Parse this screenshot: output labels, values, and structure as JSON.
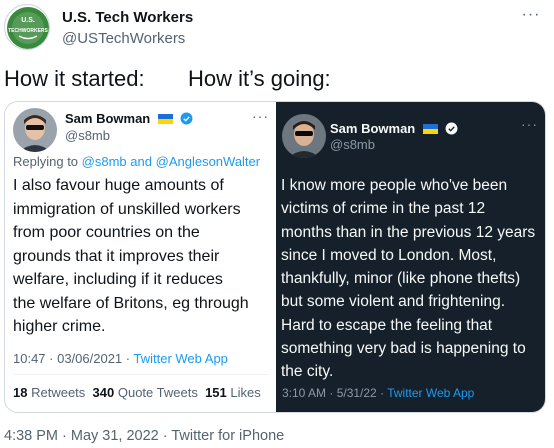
{
  "author": {
    "name": "U.S. Tech Workers",
    "handle": "@USTechWorkers",
    "logo_text_top": "U.S.",
    "logo_text_bottom": "TECHWORKERS"
  },
  "captions": {
    "left": "How it started:",
    "right": "How it’s going:"
  },
  "quoted_left": {
    "name": "Sam Bowman",
    "handle": "@s8mb",
    "replying_prefix": "Replying to",
    "reply_mention_1": "@s8mb",
    "reply_and": "and",
    "reply_mention_2": "@AnglesonWalter",
    "text_lines": [
      "I also favour huge amounts of",
      "immigration of unskilled workers",
      "from poor countries on the",
      "grounds that it improves their",
      "welfare, including if it reduces",
      "the welfare of Britons, eg through",
      "higher crime."
    ],
    "timestamp": "10:47 · 03/06/2021 ·",
    "client": "Twitter Web App",
    "stats": {
      "retweets_count": "18",
      "retweets_label": "Retweets",
      "quotes_count": "340",
      "quotes_label": "Quote Tweets",
      "likes_count": "151",
      "likes_label": "Likes"
    }
  },
  "quoted_right": {
    "name": "Sam Bowman",
    "handle": "@s8mb",
    "text_lines": [
      "I know more people who've been",
      "victims of crime in the past 12",
      "months than in the previous 12 years",
      "since I moved to London. Most,",
      "thankfully, minor (like phone thefts)",
      "but some violent and frightening.",
      "Hard to escape the feeling that",
      "something very bad is happening to",
      "the city."
    ],
    "timestamp": "3:10 AM · 5/31/22 ·",
    "client": "Twitter Web App"
  },
  "footer": {
    "meta": "4:38 PM · May 31, 2022 · Twitter for iPhone"
  },
  "colors": {
    "accent": "#1d9bf0",
    "dark_bg": "#15202b",
    "logo_green": "#3a8a3e"
  }
}
